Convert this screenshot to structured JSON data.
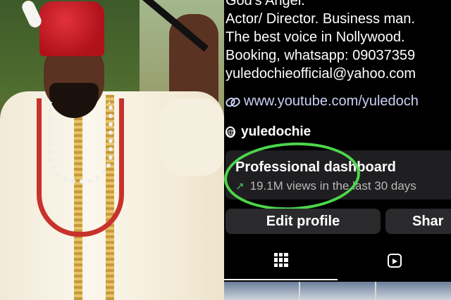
{
  "profile": {
    "bio_lines": [
      "God's Angel.",
      "Actor/ Director. Business man.",
      "The best voice in Nollywood.",
      "Booking, whatsapp: 09037359",
      "yuledochieofficial@yahoo.com"
    ],
    "link": "www.youtube.com/yuledoch",
    "threads_handle": "yuledochie"
  },
  "dashboard": {
    "title": "Professional dashboard",
    "subtitle": "19.1M views in the last 30 days"
  },
  "buttons": {
    "edit": "Edit profile",
    "share": "Shar"
  },
  "icons": {
    "link": "link-icon",
    "threads": "threads-icon",
    "trend": "trend-up-icon",
    "grid": "grid-icon",
    "reels": "reels-icon"
  },
  "colors": {
    "accent_circle": "#4cd64a",
    "link_text": "#c9d1f5",
    "trend_arrow": "#49c46b"
  }
}
